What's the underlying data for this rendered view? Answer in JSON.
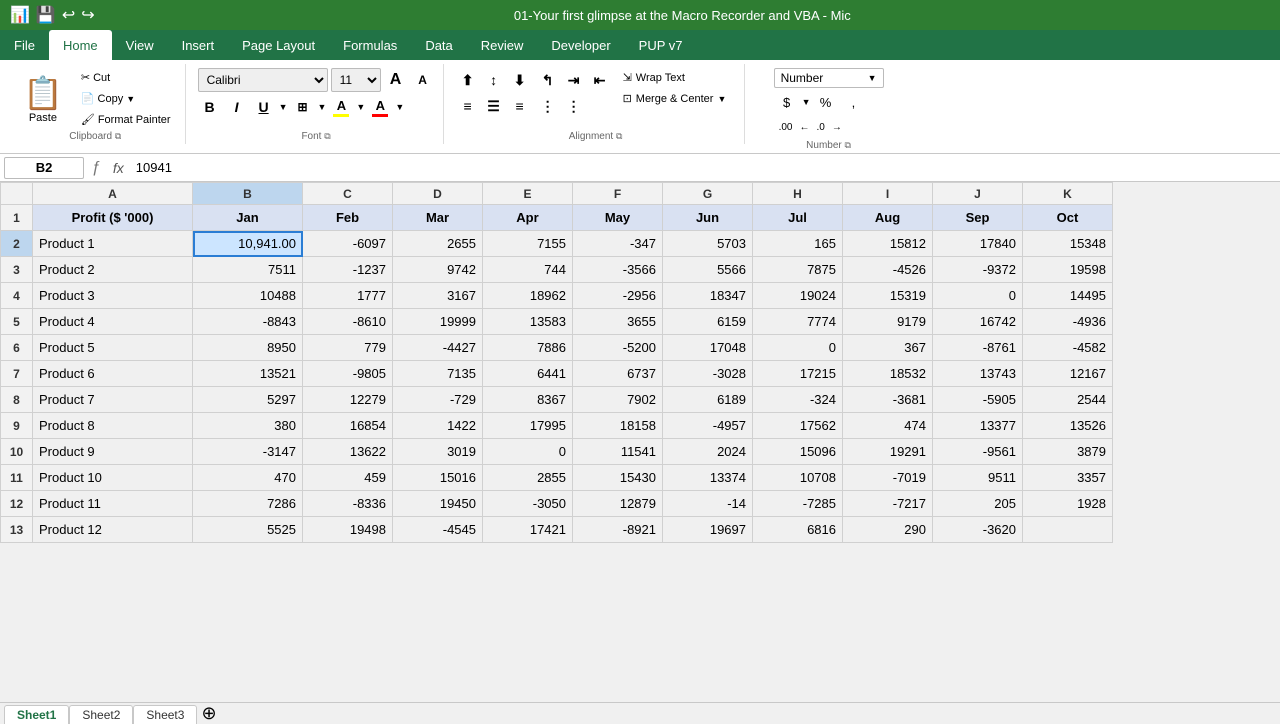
{
  "titleBar": {
    "title": "01-Your first glimpse at the Macro Recorder and VBA - Mic",
    "icons": [
      "📊",
      "💾",
      "↩",
      "↪"
    ]
  },
  "menuBar": {
    "items": [
      "File",
      "Home",
      "View",
      "Insert",
      "Page Layout",
      "Formulas",
      "Data",
      "Review",
      "Developer",
      "PUP v7"
    ],
    "activeItem": "Home"
  },
  "ribbon": {
    "clipboard": {
      "label": "Clipboard",
      "paste": "Paste",
      "cut": "Cut",
      "copy": "Copy",
      "formatPainter": "Format Painter"
    },
    "font": {
      "label": "Font",
      "fontName": "Calibri",
      "fontSize": "11",
      "bold": "B",
      "italic": "I",
      "underline": "U",
      "highlightColor": "A",
      "fontColor": "A"
    },
    "alignment": {
      "label": "Alignment",
      "wrapText": "Wrap Text",
      "mergeCenter": "Merge & Center"
    },
    "number": {
      "label": "Number",
      "format": "Number",
      "dollar": "$",
      "percent": "%",
      "comma": ",",
      "increaseDecimal": ".00",
      "decreaseDecimal": ".0"
    }
  },
  "formulaBar": {
    "cellRef": "B2",
    "fx": "fx",
    "formula": "10941"
  },
  "columns": {
    "rowHeader": "",
    "headers": [
      "A",
      "B",
      "C",
      "D",
      "E",
      "F",
      "G",
      "H",
      "I",
      "J",
      "K"
    ]
  },
  "rows": [
    {
      "rowNum": "1",
      "cells": [
        {
          "val": "Profit ($ '000)",
          "type": "text",
          "isHeader": true
        },
        {
          "val": "Jan",
          "type": "text",
          "isHeader": true
        },
        {
          "val": "Feb",
          "type": "text",
          "isHeader": true
        },
        {
          "val": "Mar",
          "type": "text",
          "isHeader": true
        },
        {
          "val": "Apr",
          "type": "text",
          "isHeader": true
        },
        {
          "val": "May",
          "type": "text",
          "isHeader": true
        },
        {
          "val": "Jun",
          "type": "text",
          "isHeader": true
        },
        {
          "val": "Jul",
          "type": "text",
          "isHeader": true
        },
        {
          "val": "Aug",
          "type": "text",
          "isHeader": true
        },
        {
          "val": "Sep",
          "type": "text",
          "isHeader": true
        },
        {
          "val": "Oct",
          "type": "text",
          "isHeader": true
        }
      ]
    },
    {
      "rowNum": "2",
      "cells": [
        {
          "val": "Product 1",
          "type": "text"
        },
        {
          "val": "10,941.00",
          "type": "num",
          "selected": true
        },
        {
          "val": "-6097",
          "type": "num"
        },
        {
          "val": "2655",
          "type": "num"
        },
        {
          "val": "7155",
          "type": "num"
        },
        {
          "val": "-347",
          "type": "num"
        },
        {
          "val": "5703",
          "type": "num"
        },
        {
          "val": "165",
          "type": "num"
        },
        {
          "val": "15812",
          "type": "num"
        },
        {
          "val": "17840",
          "type": "num"
        },
        {
          "val": "15348",
          "type": "num"
        }
      ]
    },
    {
      "rowNum": "3",
      "cells": [
        {
          "val": "Product 2",
          "type": "text"
        },
        {
          "val": "7511",
          "type": "num"
        },
        {
          "val": "-1237",
          "type": "num"
        },
        {
          "val": "9742",
          "type": "num"
        },
        {
          "val": "744",
          "type": "num"
        },
        {
          "val": "-3566",
          "type": "num"
        },
        {
          "val": "5566",
          "type": "num"
        },
        {
          "val": "7875",
          "type": "num"
        },
        {
          "val": "-4526",
          "type": "num"
        },
        {
          "val": "-9372",
          "type": "num"
        },
        {
          "val": "19598",
          "type": "num"
        }
      ]
    },
    {
      "rowNum": "4",
      "cells": [
        {
          "val": "Product 3",
          "type": "text"
        },
        {
          "val": "10488",
          "type": "num"
        },
        {
          "val": "1777",
          "type": "num"
        },
        {
          "val": "3167",
          "type": "num"
        },
        {
          "val": "18962",
          "type": "num"
        },
        {
          "val": "-2956",
          "type": "num"
        },
        {
          "val": "18347",
          "type": "num"
        },
        {
          "val": "19024",
          "type": "num"
        },
        {
          "val": "15319",
          "type": "num"
        },
        {
          "val": "0",
          "type": "num"
        },
        {
          "val": "14495",
          "type": "num"
        }
      ]
    },
    {
      "rowNum": "5",
      "cells": [
        {
          "val": "Product 4",
          "type": "text"
        },
        {
          "val": "-8843",
          "type": "num"
        },
        {
          "val": "-8610",
          "type": "num"
        },
        {
          "val": "19999",
          "type": "num"
        },
        {
          "val": "13583",
          "type": "num"
        },
        {
          "val": "3655",
          "type": "num"
        },
        {
          "val": "6159",
          "type": "num"
        },
        {
          "val": "7774",
          "type": "num"
        },
        {
          "val": "9179",
          "type": "num"
        },
        {
          "val": "16742",
          "type": "num"
        },
        {
          "val": "-4936",
          "type": "num"
        }
      ]
    },
    {
      "rowNum": "6",
      "cells": [
        {
          "val": "Product 5",
          "type": "text"
        },
        {
          "val": "8950",
          "type": "num"
        },
        {
          "val": "779",
          "type": "num"
        },
        {
          "val": "-4427",
          "type": "num"
        },
        {
          "val": "7886",
          "type": "num"
        },
        {
          "val": "-5200",
          "type": "num"
        },
        {
          "val": "17048",
          "type": "num"
        },
        {
          "val": "0",
          "type": "num"
        },
        {
          "val": "367",
          "type": "num"
        },
        {
          "val": "-8761",
          "type": "num"
        },
        {
          "val": "-4582",
          "type": "num"
        }
      ]
    },
    {
      "rowNum": "7",
      "cells": [
        {
          "val": "Product 6",
          "type": "text"
        },
        {
          "val": "13521",
          "type": "num"
        },
        {
          "val": "-9805",
          "type": "num"
        },
        {
          "val": "7135",
          "type": "num"
        },
        {
          "val": "6441",
          "type": "num"
        },
        {
          "val": "6737",
          "type": "num"
        },
        {
          "val": "-3028",
          "type": "num"
        },
        {
          "val": "17215",
          "type": "num"
        },
        {
          "val": "18532",
          "type": "num"
        },
        {
          "val": "13743",
          "type": "num"
        },
        {
          "val": "12167",
          "type": "num"
        }
      ]
    },
    {
      "rowNum": "8",
      "cells": [
        {
          "val": "Product 7",
          "type": "text"
        },
        {
          "val": "5297",
          "type": "num"
        },
        {
          "val": "12279",
          "type": "num"
        },
        {
          "val": "-729",
          "type": "num"
        },
        {
          "val": "8367",
          "type": "num"
        },
        {
          "val": "7902",
          "type": "num"
        },
        {
          "val": "6189",
          "type": "num"
        },
        {
          "val": "-324",
          "type": "num"
        },
        {
          "val": "-3681",
          "type": "num"
        },
        {
          "val": "-5905",
          "type": "num"
        },
        {
          "val": "2544",
          "type": "num"
        }
      ]
    },
    {
      "rowNum": "9",
      "cells": [
        {
          "val": "Product 8",
          "type": "text"
        },
        {
          "val": "380",
          "type": "num"
        },
        {
          "val": "16854",
          "type": "num"
        },
        {
          "val": "1422",
          "type": "num"
        },
        {
          "val": "17995",
          "type": "num"
        },
        {
          "val": "18158",
          "type": "num"
        },
        {
          "val": "-4957",
          "type": "num"
        },
        {
          "val": "17562",
          "type": "num"
        },
        {
          "val": "474",
          "type": "num"
        },
        {
          "val": "13377",
          "type": "num"
        },
        {
          "val": "13526",
          "type": "num"
        }
      ]
    },
    {
      "rowNum": "10",
      "cells": [
        {
          "val": "Product 9",
          "type": "text"
        },
        {
          "val": "-3147",
          "type": "num"
        },
        {
          "val": "13622",
          "type": "num"
        },
        {
          "val": "3019",
          "type": "num"
        },
        {
          "val": "0",
          "type": "num"
        },
        {
          "val": "11541",
          "type": "num"
        },
        {
          "val": "2024",
          "type": "num"
        },
        {
          "val": "15096",
          "type": "num"
        },
        {
          "val": "19291",
          "type": "num"
        },
        {
          "val": "-9561",
          "type": "num"
        },
        {
          "val": "3879",
          "type": "num"
        }
      ]
    },
    {
      "rowNum": "11",
      "cells": [
        {
          "val": "Product 10",
          "type": "text"
        },
        {
          "val": "470",
          "type": "num"
        },
        {
          "val": "459",
          "type": "num"
        },
        {
          "val": "15016",
          "type": "num"
        },
        {
          "val": "2855",
          "type": "num"
        },
        {
          "val": "15430",
          "type": "num"
        },
        {
          "val": "13374",
          "type": "num"
        },
        {
          "val": "10708",
          "type": "num"
        },
        {
          "val": "-7019",
          "type": "num"
        },
        {
          "val": "9511",
          "type": "num"
        },
        {
          "val": "3357",
          "type": "num"
        }
      ]
    },
    {
      "rowNum": "12",
      "cells": [
        {
          "val": "Product 11",
          "type": "text"
        },
        {
          "val": "7286",
          "type": "num"
        },
        {
          "val": "-8336",
          "type": "num"
        },
        {
          "val": "19450",
          "type": "num"
        },
        {
          "val": "-3050",
          "type": "num"
        },
        {
          "val": "12879",
          "type": "num"
        },
        {
          "val": "-14",
          "type": "num"
        },
        {
          "val": "-7285",
          "type": "num"
        },
        {
          "val": "-7217",
          "type": "num"
        },
        {
          "val": "205",
          "type": "num"
        },
        {
          "val": "1928",
          "type": "num"
        }
      ]
    },
    {
      "rowNum": "13",
      "cells": [
        {
          "val": "Product 12",
          "type": "text"
        },
        {
          "val": "5525",
          "type": "num"
        },
        {
          "val": "19498",
          "type": "num"
        },
        {
          "val": "-4545",
          "type": "num"
        },
        {
          "val": "17421",
          "type": "num"
        },
        {
          "val": "-8921",
          "type": "num"
        },
        {
          "val": "19697",
          "type": "num"
        },
        {
          "val": "6816",
          "type": "num"
        },
        {
          "val": "290",
          "type": "num"
        },
        {
          "val": "-3620",
          "type": "num"
        },
        {
          "val": "",
          "type": "num"
        }
      ]
    }
  ],
  "sheetTabs": {
    "tabs": [
      "Sheet1",
      "Sheet2",
      "Sheet3"
    ],
    "activeTab": "Sheet1"
  }
}
